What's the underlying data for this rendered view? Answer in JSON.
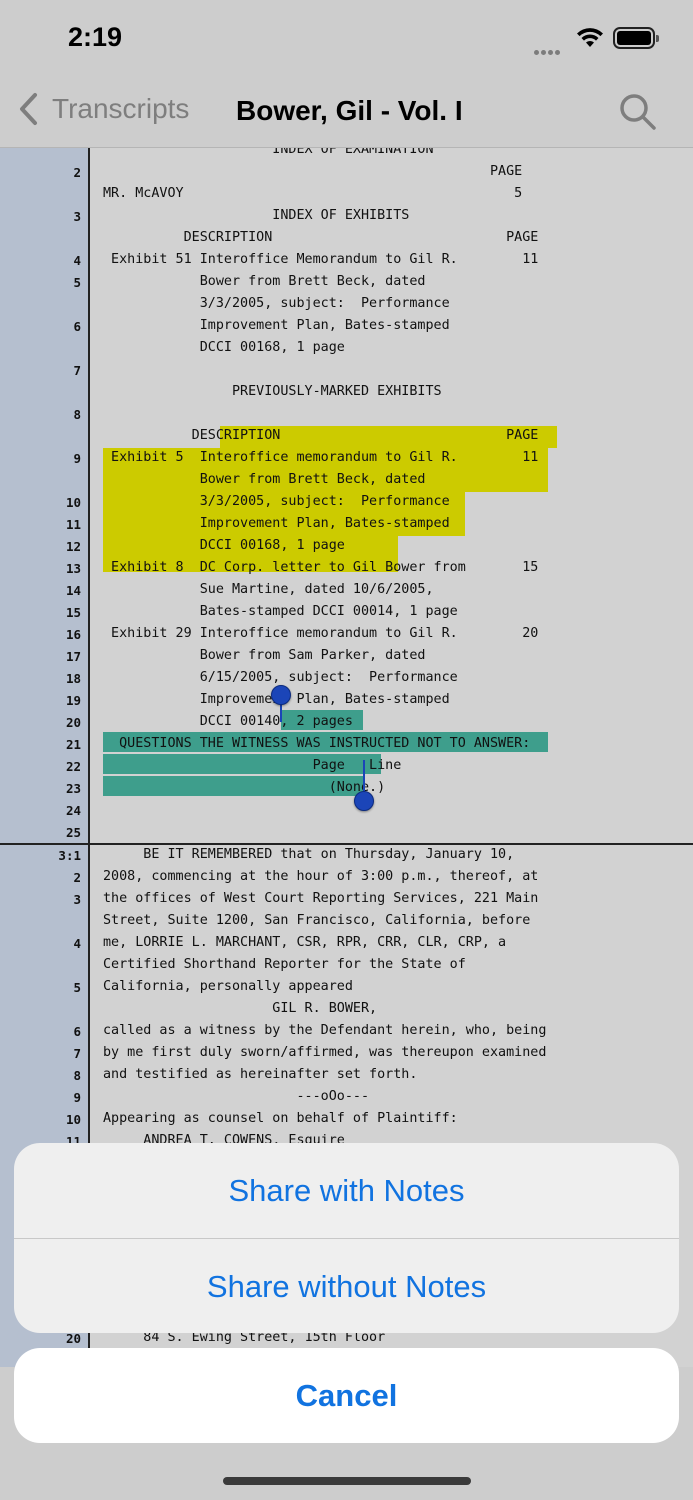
{
  "status_bar": {
    "time": "2:19"
  },
  "nav": {
    "back_label": "Transcripts",
    "title": "Bower, Gil - Vol. I"
  },
  "transcript": {
    "page2_lines": [
      {
        "num": "",
        "text": "                     INDEX OF EXAMINATION"
      },
      {
        "num": "2",
        "text": "                                                PAGE"
      },
      {
        "num": "",
        "text": "MR. McAVOY                                         5"
      },
      {
        "num": "3",
        "text": "                     INDEX OF EXHIBITS"
      },
      {
        "num": "",
        "text": "          DESCRIPTION                             PAGE"
      },
      {
        "num": "4",
        "text": " Exhibit 51 Interoffice Memorandum to Gil R.        11"
      },
      {
        "num": "5",
        "text": "            Bower from Brett Beck, dated"
      },
      {
        "num": "",
        "text": "            3/3/2005, subject:  Performance"
      },
      {
        "num": "6",
        "text": "            Improvement Plan, Bates-stamped"
      },
      {
        "num": "",
        "text": "            DCCI 00168, 1 page"
      },
      {
        "num": "7",
        "text": ""
      },
      {
        "num": "",
        "text": "                PREVIOUSLY-MARKED EXHIBITS"
      },
      {
        "num": "8",
        "text": ""
      },
      {
        "num": "",
        "text": "           DESCRIPTION                            PAGE"
      },
      {
        "num": "9",
        "text": " Exhibit 5  Interoffice memorandum to Gil R.        11"
      },
      {
        "num": "",
        "text": "            Bower from Brett Beck, dated"
      },
      {
        "num": "10",
        "text": "            3/3/2005, subject:  Performance"
      },
      {
        "num": "11",
        "text": "            Improvement Plan, Bates-stamped"
      },
      {
        "num": "12",
        "text": "            DCCI 00168, 1 page"
      },
      {
        "num": "13",
        "text": " Exhibit 8  DC Corp. letter to Gil Bower from       15"
      },
      {
        "num": "14",
        "text": "            Sue Martine, dated 10/6/2005,"
      },
      {
        "num": "15",
        "text": "            Bates-stamped DCCI 00014, 1 page"
      },
      {
        "num": "16",
        "text": " Exhibit 29 Interoffice memorandum to Gil R.        20"
      },
      {
        "num": "17",
        "text": "            Bower from Sam Parker, dated"
      },
      {
        "num": "18",
        "text": "            6/15/2005, subject:  Performance"
      },
      {
        "num": "19",
        "text": "            Improvement Plan, Bates-stamped"
      },
      {
        "num": "20",
        "text": "            DCCI 00140, 2 pages"
      },
      {
        "num": "21",
        "text": "  QUESTIONS THE WITNESS WAS INSTRUCTED NOT TO ANSWER:"
      },
      {
        "num": "22",
        "text": "                          Page   Line"
      },
      {
        "num": "23",
        "text": "                            (None.)"
      },
      {
        "num": "24",
        "text": ""
      },
      {
        "num": "25",
        "text": ""
      }
    ],
    "page3_lines": [
      {
        "num": "3:1",
        "text": "     BE IT REMEMBERED that on Thursday, January 10,"
      },
      {
        "num": "2",
        "text": "2008, commencing at the hour of 3:00 p.m., thereof, at"
      },
      {
        "num": "3",
        "text": "the offices of West Court Reporting Services, 221 Main"
      },
      {
        "num": "",
        "text": "Street, Suite 1200, San Francisco, California, before"
      },
      {
        "num": "4",
        "text": "me, LORRIE L. MARCHANT, CSR, RPR, CRR, CLR, CRP, a"
      },
      {
        "num": "",
        "text": "Certified Shorthand Reporter for the State of"
      },
      {
        "num": "5",
        "text": "California, personally appeared"
      },
      {
        "num": "",
        "text": "                     GIL R. BOWER,"
      },
      {
        "num": "6",
        "text": "called as a witness by the Defendant herein, who, being"
      },
      {
        "num": "7",
        "text": "by me first duly sworn/affirmed, was thereupon examined"
      },
      {
        "num": "8",
        "text": "and testified as hereinafter set forth."
      },
      {
        "num": "9",
        "text": "                        ---oOo---"
      },
      {
        "num": "10",
        "text": "Appearing as counsel on behalf of Plaintiff:"
      },
      {
        "num": "11",
        "text": "     ANDREA T. COWENS, Esquire"
      }
    ],
    "bottom_line": {
      "num": "20",
      "text": "     84 S. Ewing Street, 15th Floor"
    }
  },
  "action_sheet": {
    "share_with_notes": "Share with Notes",
    "share_without_notes": "Share without Notes",
    "cancel": "Cancel"
  },
  "colors": {
    "accent": "#1173e0",
    "highlight_yellow": "#cccb00",
    "highlight_teal": "#3e9e8c",
    "gutter": "#b5bfcf"
  }
}
